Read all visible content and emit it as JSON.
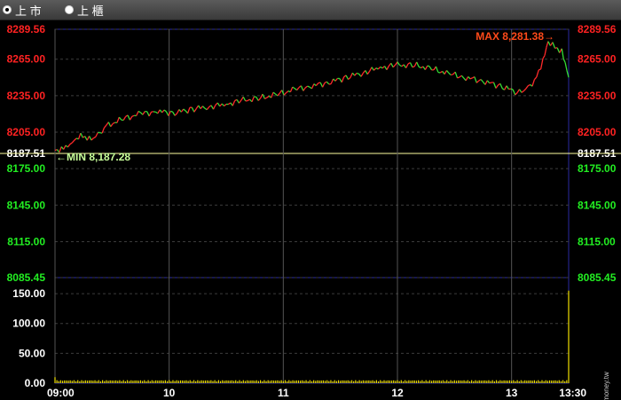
{
  "toolbar": {
    "options": [
      {
        "label": "上 市",
        "selected": true
      },
      {
        "label": "上 櫃",
        "selected": false
      }
    ]
  },
  "watermark": "©cmoney.tw",
  "colors": {
    "rise": "#ff2a2a",
    "fall": "#33dd33",
    "volume": "#f0e000",
    "ref_line": "#ffffa0",
    "max_label": "#ff4a1a",
    "min_label": "#c8ff9a",
    "grid": "#3c3c3c",
    "frame": "#2a2aa0"
  },
  "chart_data": [
    {
      "type": "line",
      "name": "price",
      "x_labels": [
        "09:00",
        "10",
        "11",
        "12",
        "13",
        "13:30"
      ],
      "y_ticks": [
        {
          "label": "8289.56",
          "value": 8289.56,
          "color": "red"
        },
        {
          "label": "8265.00",
          "value": 8265.0,
          "color": "red"
        },
        {
          "label": "8235.00",
          "value": 8235.0,
          "color": "red"
        },
        {
          "label": "8205.00",
          "value": 8205.0,
          "color": "red"
        },
        {
          "label": "8187.51",
          "value": 8187.51,
          "color": "white"
        },
        {
          "label": "8175.00",
          "value": 8175.0,
          "color": "green"
        },
        {
          "label": "8145.00",
          "value": 8145.0,
          "color": "green"
        },
        {
          "label": "8115.00",
          "value": 8115.0,
          "color": "green"
        },
        {
          "label": "8085.45",
          "value": 8085.45,
          "color": "green"
        }
      ],
      "ylim": [
        8085.45,
        8289.56
      ],
      "reference": 8187.51,
      "max_label": "MAX 8,281.38→",
      "min_label": "←MIN 8,187.28",
      "max": 8281.38,
      "min": 8187.28,
      "series_points": [
        [
          0,
          8190
        ],
        [
          5,
          8192
        ],
        [
          10,
          8197
        ],
        [
          15,
          8203
        ],
        [
          20,
          8199
        ],
        [
          25,
          8202
        ],
        [
          30,
          8210
        ],
        [
          40,
          8216
        ],
        [
          50,
          8220
        ],
        [
          60,
          8222
        ],
        [
          70,
          8221
        ],
        [
          80,
          8224
        ],
        [
          90,
          8226
        ],
        [
          100,
          8228
        ],
        [
          110,
          8231
        ],
        [
          120,
          8233
        ],
        [
          130,
          8236
        ],
        [
          140,
          8240
        ],
        [
          150,
          8243
        ],
        [
          160,
          8246
        ],
        [
          170,
          8250
        ],
        [
          180,
          8254
        ],
        [
          190,
          8258
        ],
        [
          200,
          8260
        ],
        [
          210,
          8260
        ],
        [
          220,
          8257
        ],
        [
          230,
          8253
        ],
        [
          240,
          8250
        ],
        [
          250,
          8247
        ],
        [
          260,
          8243
        ],
        [
          270,
          8238
        ],
        [
          275,
          8241
        ],
        [
          280,
          8247
        ],
        [
          285,
          8263
        ],
        [
          288,
          8280
        ],
        [
          292,
          8275
        ],
        [
          296,
          8271
        ],
        [
          298,
          8262
        ],
        [
          300,
          8250
        ]
      ],
      "x_minutes_range": [
        0,
        270
      ]
    },
    {
      "type": "bar",
      "name": "volume",
      "y_ticks": [
        {
          "label": "150.00",
          "value": 150
        },
        {
          "label": "100.00",
          "value": 100
        },
        {
          "label": "50.00",
          "value": 50
        },
        {
          "label": "0.00",
          "value": 0
        }
      ],
      "ylim": [
        0,
        165
      ],
      "x_minutes_range": [
        0,
        270
      ],
      "baseline_value": 3,
      "first_value": 10,
      "last_value": 155
    }
  ]
}
